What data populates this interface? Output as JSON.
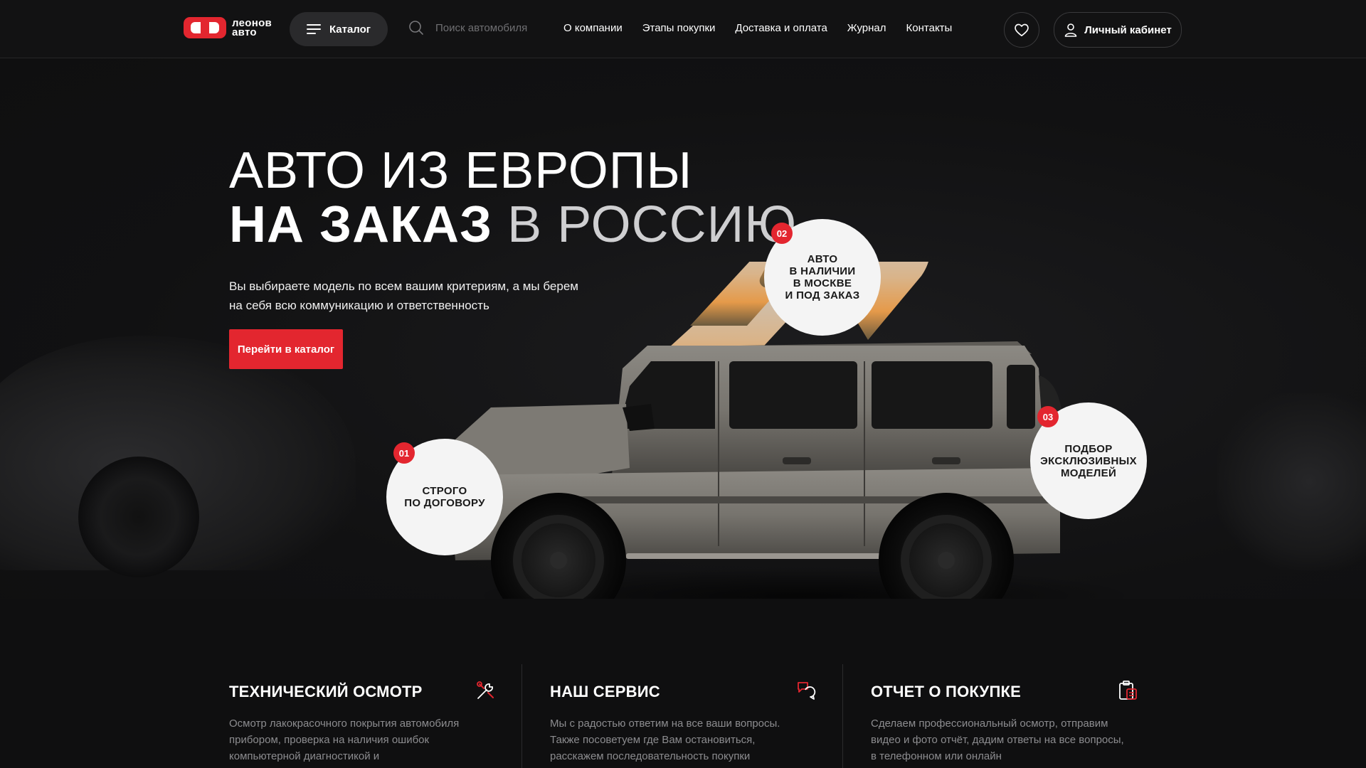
{
  "header": {
    "logo": {
      "line1": "леонов",
      "line2": "авто"
    },
    "catalog_label": "Каталог",
    "search_placeholder": "Поиск автомобиля",
    "nav": [
      "О компании",
      "Этапы покупки",
      "Доставка и оплата",
      "Журнал",
      "Контакты"
    ],
    "favorites_icon": "heart-icon",
    "account_label": "Личный кабинет"
  },
  "hero": {
    "title_line1": "АВТО ИЗ ЕВРОПЫ",
    "title_line2_bold": "НА ЗАКАЗ",
    "title_line2_rest": " В РОССИЮ",
    "subtitle": "Вы выбираете модель по всем вашим критериям, а мы берем на себя всю коммуникацию и ответственность",
    "cta_label": "Перейти в каталог",
    "features": [
      {
        "num": "01",
        "text": "СТРОГО\nПО ДОГОВОРУ"
      },
      {
        "num": "02",
        "text": "АВТО\nВ НАЛИЧИИ\nВ МОСКВЕ\nИ ПОД ЗАКАЗ"
      },
      {
        "num": "03",
        "text": "ПОДБОР\nЭКСКЛЮЗИВНЫХ\nМОДЕЛЕЙ"
      }
    ]
  },
  "services": [
    {
      "title": "ТЕХНИЧЕСКИЙ ОСМОТР",
      "icon": "tools-icon",
      "text": "Осмотр лакокрасочного покрытия автомобиля прибором, проверка на наличия ошибок компьютерной диагностикой и"
    },
    {
      "title": "НАШ СЕРВИС",
      "icon": "chat-bubbles-icon",
      "text": "Мы с радостью ответим на все ваши вопросы. Также посоветуем где Вам остановиться, расскажем последовательность покупки"
    },
    {
      "title": "ОТЧЕТ О ПОКУПКЕ",
      "icon": "clipboard-report-icon",
      "text": "Сделаем профессиональный осмотр, отправим видео и фото отчёт, дадим ответы на все вопросы, в телефонном или онлайн"
    }
  ],
  "colors": {
    "accent": "#e3262f",
    "background": "#0f0f10",
    "muted_text": "#8c8c8f"
  }
}
